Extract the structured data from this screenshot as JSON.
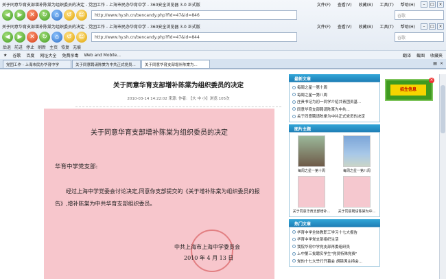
{
  "window1": {
    "title": "关于同意华育支部增补陈棠为组织委员的决定 - 党团工作 - 上海市民办华育中学 - 360安全浏览器 3.0 正式版"
  },
  "window2": {
    "title": "关于同意华育支部增补陈棠为组织委员的决定 - 党团工作 - 上海市民办华育中学 - 360安全浏览器 3.0 正式版",
    "url": "http://www.hy.sh.cn/bencandy.php?fid=47&id=844"
  },
  "top_nav": {
    "url": "http://www.hy.sh.cn/bencandy.php?fid=47&id=846",
    "search_placeholder": "谷歌"
  },
  "menu": [
    "文件(F)",
    "查看(V)",
    "收藏(B)",
    "工具(T)",
    "帮助(H)"
  ],
  "nav_labels": [
    "后退",
    "前进",
    "停止",
    "刷新",
    "主页",
    "恢复",
    "无痕"
  ],
  "favbar": {
    "items": [
      "谷歌",
      "百度",
      "网址大全",
      "免费杀毒",
      "Web and Mobile..."
    ],
    "right": [
      "翻译",
      "截图",
      "收藏夹"
    ]
  },
  "tabs": [
    "党团工作 - 上海市民办华育中学",
    "关于同意聘请陈棠为中共正式党员...",
    "关于同意华育支部增补陈棠为..."
  ],
  "article": {
    "title": "关于同意华育支部增补陈棠为组织委员的决定",
    "meta": "2010-03-14 14:22:02  来源:  作者:  【大  中  小】浏览:105次"
  },
  "document": {
    "title": "关于同意华育支部增补陈棠为组织委员的决定",
    "addressee": "华育中学党支部:",
    "body": "经过上海中学党委会讨论决定,同意你支部提交的《关于增补陈棠为组织委员的报告》,增补陈棠为中共华育支部组织委员。",
    "signature": "中共上海市上海中学委员会",
    "date": "2010 年 4 月 13 日"
  },
  "sidebar": {
    "latest": {
      "title": "最新文章",
      "items": [
        "每周之星一第十周",
        "每周之星一第八周",
        "庄贵书记为初一同学介绍共青团员基...",
        "同意华育支部聘请陈某为中共...",
        "关于同意聘请陈棠为中共正式党员的决定"
      ]
    },
    "pics": {
      "title": "图片主题",
      "items": [
        "每周之星一第十周",
        "每周之星一第八周",
        "关于同意华育支部增补...",
        "关于同意聘请陈棠为中..."
      ]
    },
    "hot": {
      "title": "热门文章",
      "items": [
        "华育中学全体教职工学习十七大报告",
        "华育中学党支部组织生活",
        "我院华育中学党支部再委组织员",
        "上中第三批聘实学生\"党员特殊党费\"",
        "党的十七大举行开幕会 胡锦涛主持会..."
      ]
    }
  },
  "ad": {
    "label": "招生信息"
  }
}
